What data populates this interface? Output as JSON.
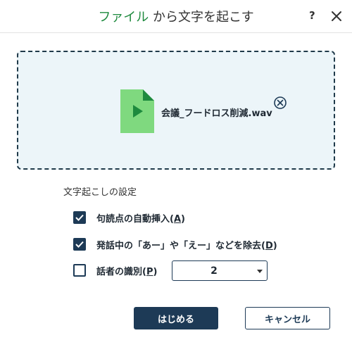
{
  "dialog": {
    "title_accent": "ファイル",
    "title_rest": " から文字を起こす",
    "help_label": "?"
  },
  "file": {
    "name": "会議_フードロス削減.wav"
  },
  "settings": {
    "section_title": "文字起こしの設定",
    "options": [
      {
        "label": "句読点の自動挿入(",
        "mnemonic": "A",
        "label_end": ")",
        "checked": true
      },
      {
        "label": "発話中の「あー」や「えー」などを除去(",
        "mnemonic": "D",
        "label_end": ")",
        "checked": true
      },
      {
        "label": "話者の識別(",
        "mnemonic": "P",
        "label_end": ")",
        "checked": false
      }
    ],
    "speaker_count": "2"
  },
  "buttons": {
    "start": "はじめる",
    "cancel": "キャンセル"
  },
  "colors": {
    "accent_green": "#1e8a3e",
    "navy": "#1d3a56",
    "dropzone_bg": "#ecf5f9",
    "file_icon_green": "#7fd97f"
  }
}
